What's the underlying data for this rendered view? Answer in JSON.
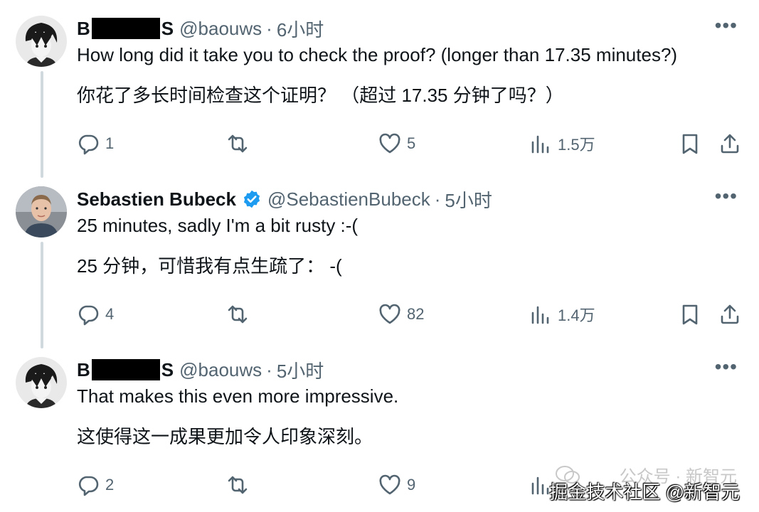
{
  "tweets": [
    {
      "name_start": "B",
      "name_end": "S",
      "handle": "@baouws",
      "dot": "·",
      "time": "6小时",
      "more": "•••",
      "text_en": "How long did it take you to check the proof?  (longer than 17.35 minutes?)",
      "text_zh": "你花了多长时间检查这个证明？ （超过 17.35 分钟了吗？）",
      "replies": "1",
      "likes": "5",
      "views": "1.5万"
    },
    {
      "name": "Sebastien Bubeck",
      "handle": "@SebastienBubeck",
      "dot": "·",
      "time": "5小时",
      "more": "•••",
      "text_en": "25 minutes, sadly I'm a bit rusty :-(",
      "text_zh": "25 分钟，可惜我有点生疏了： -(",
      "replies": "4",
      "likes": "82",
      "views": "1.4万"
    },
    {
      "name_start": "B",
      "name_end": "S",
      "handle": "@baouws",
      "dot": "·",
      "time": "5小时",
      "more": "•••",
      "text_en": "That makes this even more impressive.",
      "text_zh": "这使得这一成果更加令人印象深刻。",
      "replies": "2",
      "likes": "9",
      "views": ""
    }
  ],
  "watermark": {
    "line1": "公众号 · 新智元",
    "line2": "掘金技术社区 @新智元"
  },
  "colors": {
    "text": "#0f1419",
    "secondary": "#536471",
    "verified": "#1d9bf0",
    "thread_line": "#cfd9de"
  }
}
